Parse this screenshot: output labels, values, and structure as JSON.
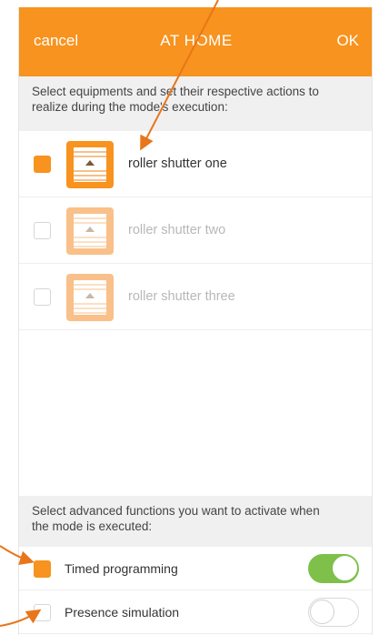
{
  "header": {
    "cancel_label": "cancel",
    "title": "AT HOME",
    "ok_label": "OK",
    "background": "#f7931e"
  },
  "equipment_section": {
    "instruction": "Select equipments and set their respective actions to realize during the mode's execution:",
    "items": [
      {
        "label": "roller shutter one",
        "checked": true,
        "icon": "roller-shutter-icon"
      },
      {
        "label": "roller shutter two",
        "checked": false,
        "icon": "roller-shutter-icon"
      },
      {
        "label": "roller shutter three",
        "checked": false,
        "icon": "roller-shutter-icon"
      }
    ]
  },
  "advanced_section": {
    "instruction": "Select advanced functions you want to activate when the mode is executed:",
    "functions": [
      {
        "label": "Timed programming",
        "checked": true,
        "toggle_on": true
      },
      {
        "label": "Presence simulation",
        "checked": false,
        "toggle_on": false
      }
    ]
  },
  "colors": {
    "accent": "#f7931e",
    "toggle_on": "#7ec04a",
    "annotation": "#e8761a"
  }
}
